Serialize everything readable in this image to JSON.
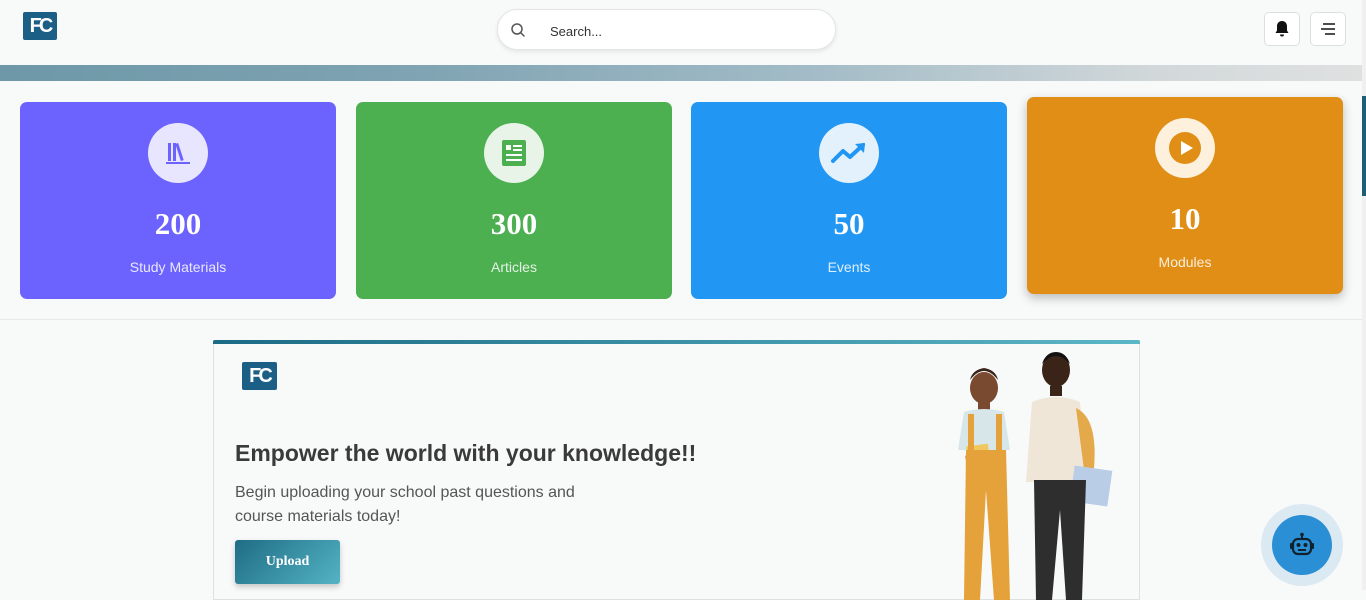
{
  "header": {
    "logo_text": "FC",
    "search_placeholder": "Search..."
  },
  "stats": [
    {
      "value": "200",
      "label": "Study Materials",
      "color": "#6c63ff",
      "icon": "books-icon"
    },
    {
      "value": "300",
      "label": "Articles",
      "color": "#4caf50",
      "icon": "article-icon"
    },
    {
      "value": "50",
      "label": "Events",
      "color": "#2196f3",
      "icon": "trending-up-icon"
    },
    {
      "value": "10",
      "label": "Modules",
      "color": "#e08e15",
      "icon": "play-circle-icon"
    }
  ],
  "banner": {
    "logo_text": "FC",
    "headline": "Empower the world with your knowledge!!",
    "subtext": "Begin uploading your school past questions and course materials today!",
    "button_label": "Upload"
  },
  "colors": {
    "brand": "#1c5f86",
    "accent_teal": "#1f6d85",
    "bot": "#2a8fd4"
  }
}
